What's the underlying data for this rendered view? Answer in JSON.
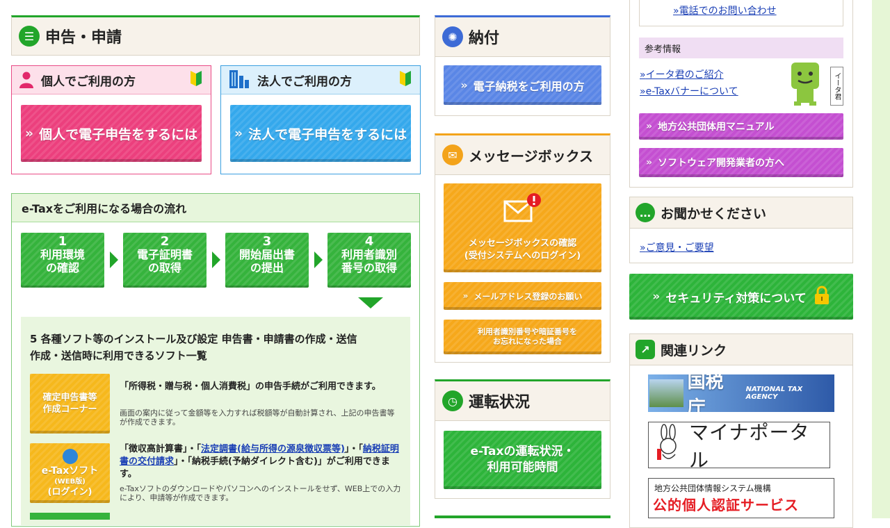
{
  "shinkoku": {
    "title": "申告・申請",
    "individual": {
      "label": "個人でご利用の方",
      "button": "個人で電子申告をするには"
    },
    "corporate": {
      "label": "法人でご利用の方",
      "button": "法人で電子申告をするには"
    }
  },
  "flow": {
    "title": "e-Taxをご利用になる場合の流れ",
    "steps": [
      {
        "num": "1",
        "line1": "利用環境",
        "line2": "の確認"
      },
      {
        "num": "2",
        "line1": "電子証明書",
        "line2": "の取得"
      },
      {
        "num": "3",
        "line1": "開始届出書",
        "line2": "の提出"
      },
      {
        "num": "4",
        "line1": "利用者識別",
        "line2": "番号の取得"
      }
    ],
    "step5_title": "5 各種ソフト等のインストール及び設定 申告書・申請書の作成・送信",
    "software_title": "作成・送信時に利用できるソフト一覧",
    "corner": {
      "button_line1": "確定申告書等",
      "button_line2": "作成コーナー",
      "desc": "「所得税・贈与税・個人消費税」の申告手続がご利用できます。",
      "small": "画面の案内に従って金額等を入力すれば税額等が自動計算され、上記の申告書等が作成できます。"
    },
    "websoft": {
      "button_line1": "e-Taxソフト",
      "button_line2": "(WEB版)",
      "button_line3": "(ログイン)",
      "desc_a": "「徴収高計算書」・「",
      "link_a": "法定調書(給与所得の源泉徴収票等)",
      "desc_b": "」・「",
      "link_b": "納税証明書の交付請求",
      "desc_c": "」・「納税手続(予納ダイレクト含む)」がご利用できます。",
      "small": "e-Taxソフトのダウンロードやパソコンへのインストールをせず、WEB上での入力により、申請等が作成できます。"
    }
  },
  "payment": {
    "title": "納付",
    "button": "電子納税をご利用の方"
  },
  "messagebox": {
    "title": "メッセージボックス",
    "confirm_line1": "メッセージボックスの確認",
    "confirm_line2": "(受付システムへのログイン)",
    "mail_button": "メールアドレス登録のお願い",
    "forgot_line1": "利用者識別番号や暗証番号を",
    "forgot_line2": "お忘れになった場合"
  },
  "operation": {
    "title": "運転状況",
    "button_line1": "e-Taxの運転状況・",
    "button_line2": "利用可能時間"
  },
  "contact": {
    "phone_link": "電話でのお問い合わせ"
  },
  "reference": {
    "title": "参考情報",
    "links": [
      "イータ君のご紹介",
      "e-Taxバナーについて"
    ],
    "mascot_label": "イータ君",
    "buttons": [
      "地方公共団体用マニュアル",
      "ソフトウェア開発業者の方へ"
    ]
  },
  "feedback": {
    "title": "お聞かせください",
    "link": "ご意見・ご要望"
  },
  "security": {
    "button": "セキュリティ対策について"
  },
  "related": {
    "title": "関連リンク",
    "nta": {
      "jp": "国税庁",
      "en": "NATIONAL TAX AGENCY"
    },
    "mynaportal": "マイナポータル",
    "jpki": {
      "org": "地方公共団体情報システム機構",
      "name": "公的個人認証サービス"
    }
  }
}
